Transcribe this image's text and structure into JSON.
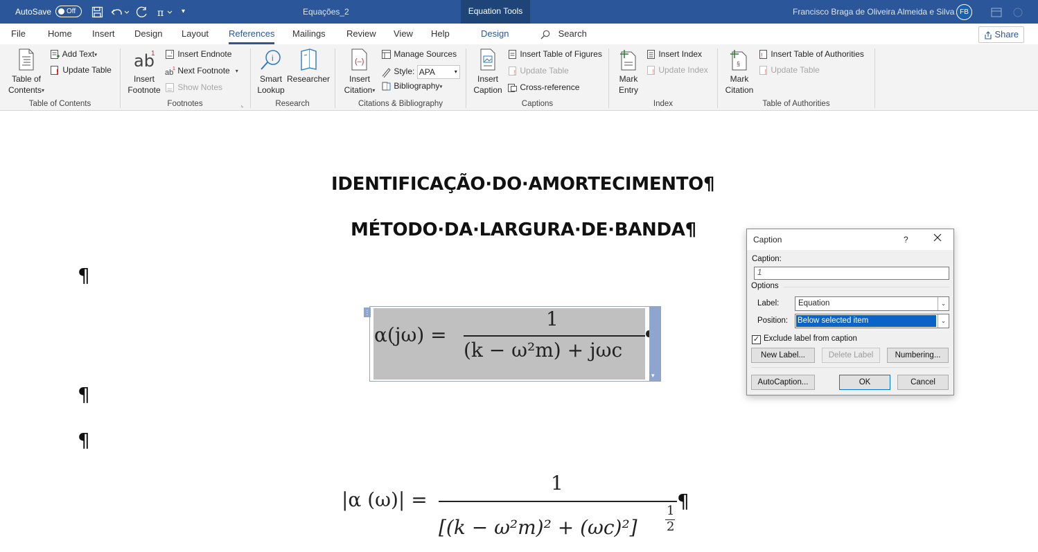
{
  "titlebar": {
    "autosave_label": "AutoSave",
    "autosave_state": "Off",
    "doc_title": "Equações_2",
    "context_tab": "Equation Tools",
    "user_name": "Francisco Braga de Oliveira Almeida e Silva",
    "user_initials": "FB"
  },
  "menu": {
    "tabs": [
      "File",
      "Home",
      "Insert",
      "Design",
      "Layout",
      "References",
      "Mailings",
      "Review",
      "View",
      "Help",
      "Design"
    ],
    "active_tab": "References",
    "search_label": "Search",
    "share_label": "Share"
  },
  "ribbon": {
    "toc": {
      "big_label_1": "Table of",
      "big_label_2": "Contents",
      "add_text": "Add Text",
      "update_table": "Update Table",
      "group": "Table of Contents"
    },
    "footnotes": {
      "big_label_1": "Insert",
      "big_label_2": "Footnote",
      "insert_endnote": "Insert Endnote",
      "next_footnote": "Next Footnote",
      "show_notes": "Show Notes",
      "group": "Footnotes"
    },
    "research": {
      "smart_1": "Smart",
      "smart_2": "Lookup",
      "researcher": "Researcher",
      "group": "Research"
    },
    "citations": {
      "big_label_1": "Insert",
      "big_label_2": "Citation",
      "manage_sources": "Manage Sources",
      "style_label": "Style:",
      "style_value": "APA",
      "bibliography": "Bibliography",
      "group": "Citations & Bibliography"
    },
    "captions": {
      "big_label_1": "Insert",
      "big_label_2": "Caption",
      "insert_tof": "Insert Table of Figures",
      "update_table": "Update Table",
      "cross_ref": "Cross-reference",
      "group": "Captions"
    },
    "index": {
      "big_label_1": "Mark",
      "big_label_2": "Entry",
      "insert_index": "Insert Index",
      "update_index": "Update Index",
      "group": "Index"
    },
    "toa": {
      "big_label_1": "Mark",
      "big_label_2": "Citation",
      "insert_toa": "Insert Table of Authorities",
      "update_table": "Update Table",
      "group": "Table of Authorities"
    }
  },
  "document": {
    "heading1": "IDENTIFICAÇÃO·DO·AMORTECIMENTO¶",
    "heading2": "MÉTODO·DA·LARGURA·DE·BANDA¶",
    "pilcrow": "¶",
    "eq1": {
      "lhs": "α(jω) =",
      "numerator": "1",
      "denominator": "(k − ω²m) + jωc"
    },
    "eq2": {
      "lhs": "|α (ω)| =",
      "numerator": "1",
      "denominator": "[(k − ω²m)² + (ωc)²]",
      "exponent_num": "1",
      "exponent_den": "2",
      "trailing": "¶"
    }
  },
  "dialog": {
    "title": "Caption",
    "help": "?",
    "caption_label": "Caption:",
    "caption_value": "1",
    "options_label": "Options",
    "label_label": "Label:",
    "label_value": "Equation",
    "position_label": "Position:",
    "position_value": "Below selected item",
    "exclude_label": "Exclude label from caption",
    "exclude_checked": true,
    "new_label_btn": "New Label...",
    "delete_label_btn": "Delete Label",
    "numbering_btn": "Numbering...",
    "autocaption_btn": "AutoCaption...",
    "ok_btn": "OK",
    "cancel_btn": "Cancel"
  },
  "colors": {
    "titlebar": "#2b579a",
    "context_tab": "#1e4478",
    "selection": "#0a64c8",
    "equation_highlight": "#c0c0c0"
  }
}
